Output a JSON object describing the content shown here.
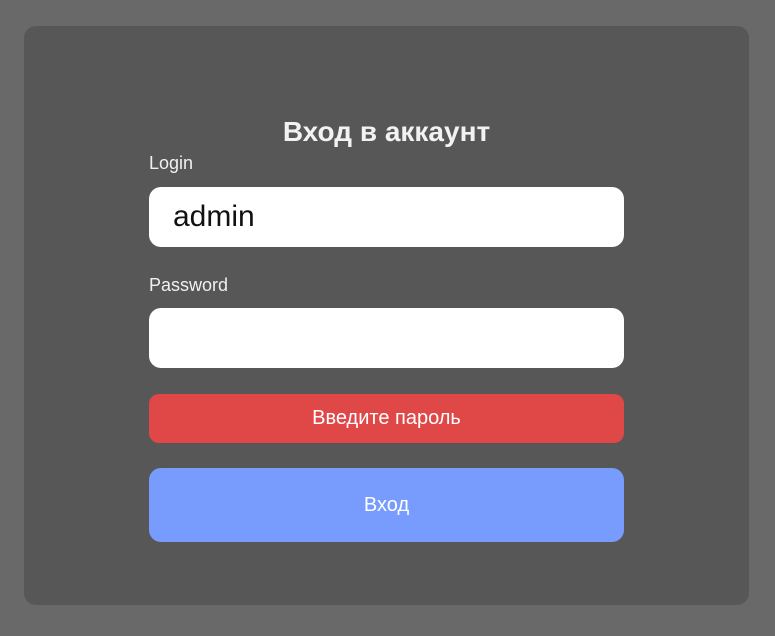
{
  "login_form": {
    "title": "Вход в аккаунт",
    "login_label": "Login",
    "login_value": "admin",
    "password_label": "Password",
    "password_value": "",
    "error_message": "Введите пароль",
    "submit_label": "Вход"
  },
  "colors": {
    "page_background": "#696969",
    "card_background": "#575757",
    "error": "#e04848",
    "submit": "#789cfd"
  }
}
